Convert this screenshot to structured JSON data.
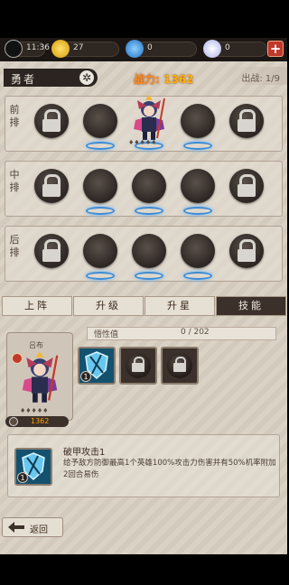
{
  "status_bar": {
    "time": "11:36",
    "gold": "27",
    "gems": "0",
    "crystals": "0",
    "add_label": "+",
    "colors": {
      "gold": "#f0b400",
      "gem": "#2f8fe0",
      "crystal": "#d8dcf8"
    }
  },
  "header": {
    "team_name": "勇者",
    "power_label": "战力:",
    "power_value": "1362",
    "deploy_label": "出战: 1/9"
  },
  "formation": {
    "rows": [
      {
        "label": "前排",
        "slots": [
          "locked",
          "empty",
          "hero",
          "empty",
          "locked"
        ]
      },
      {
        "label": "中排",
        "slots": [
          "locked",
          "empty",
          "empty",
          "empty",
          "locked"
        ]
      },
      {
        "label": "后排",
        "slots": [
          "locked",
          "empty",
          "empty",
          "empty",
          "locked"
        ]
      }
    ],
    "hero_stars": "♦♦♦♦♦"
  },
  "tabs": [
    {
      "label": "上阵",
      "active": false
    },
    {
      "label": "升级",
      "active": false
    },
    {
      "label": "升星",
      "active": false
    },
    {
      "label": "技能",
      "active": true
    }
  ],
  "hero": {
    "name": "吕布",
    "power": "1362",
    "stars": "♦♦♦♦♦"
  },
  "insight": {
    "label": "悟性值",
    "value": "0 / 202"
  },
  "skills": [
    {
      "state": "unlocked",
      "level": "1",
      "icon": "shield-break-icon"
    },
    {
      "state": "locked",
      "icon": "lock-icon"
    },
    {
      "state": "locked",
      "icon": "lock-icon"
    }
  ],
  "skill_detail": {
    "level": "1",
    "title": "破甲攻击1",
    "description": "给予敌方防御最高1个英雄100%攻击力伤害并有50%机率附加2回合易伤"
  },
  "back_button": {
    "label": "返回"
  }
}
